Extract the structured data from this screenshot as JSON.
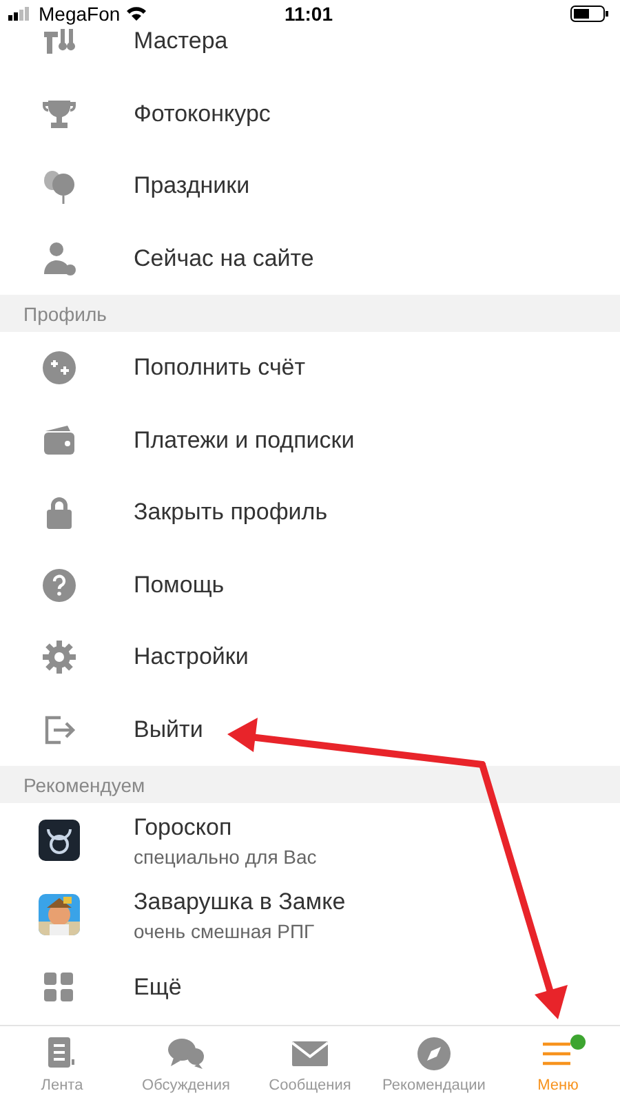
{
  "status_bar": {
    "carrier": "MegaFon",
    "time": "11:01"
  },
  "sections": [
    {
      "items": [
        {
          "kind": "icon",
          "label": "Мастера"
        },
        {
          "kind": "icon",
          "label": "Фотоконкурс"
        },
        {
          "kind": "icon",
          "label": "Праздники"
        },
        {
          "kind": "icon",
          "label": "Сейчас на сайте"
        }
      ]
    },
    {
      "header": "Профиль",
      "items": [
        {
          "kind": "icon",
          "label": "Пополнить счёт"
        },
        {
          "kind": "icon",
          "label": "Платежи и подписки"
        },
        {
          "kind": "icon",
          "label": "Закрыть профиль"
        },
        {
          "kind": "icon",
          "label": "Помощь"
        },
        {
          "kind": "icon",
          "label": "Настройки"
        },
        {
          "kind": "icon",
          "label": "Выйти"
        }
      ]
    },
    {
      "header": "Рекомендуем",
      "items": [
        {
          "kind": "app",
          "label": "Гороскоп",
          "subtitle": "специально для Вас"
        },
        {
          "kind": "app",
          "label": "Заварушка в Замке",
          "subtitle": "очень смешная РПГ"
        },
        {
          "kind": "icon",
          "label": "Ещё"
        }
      ]
    }
  ],
  "tabs": [
    {
      "label": "Лента",
      "selected": false,
      "dot": false
    },
    {
      "label": "Обсуждения",
      "selected": false,
      "dot": false
    },
    {
      "label": "Сообщения",
      "selected": false,
      "dot": false
    },
    {
      "label": "Рекомендации",
      "selected": false,
      "dot": false
    },
    {
      "label": "Меню",
      "selected": true,
      "dot": true
    }
  ]
}
